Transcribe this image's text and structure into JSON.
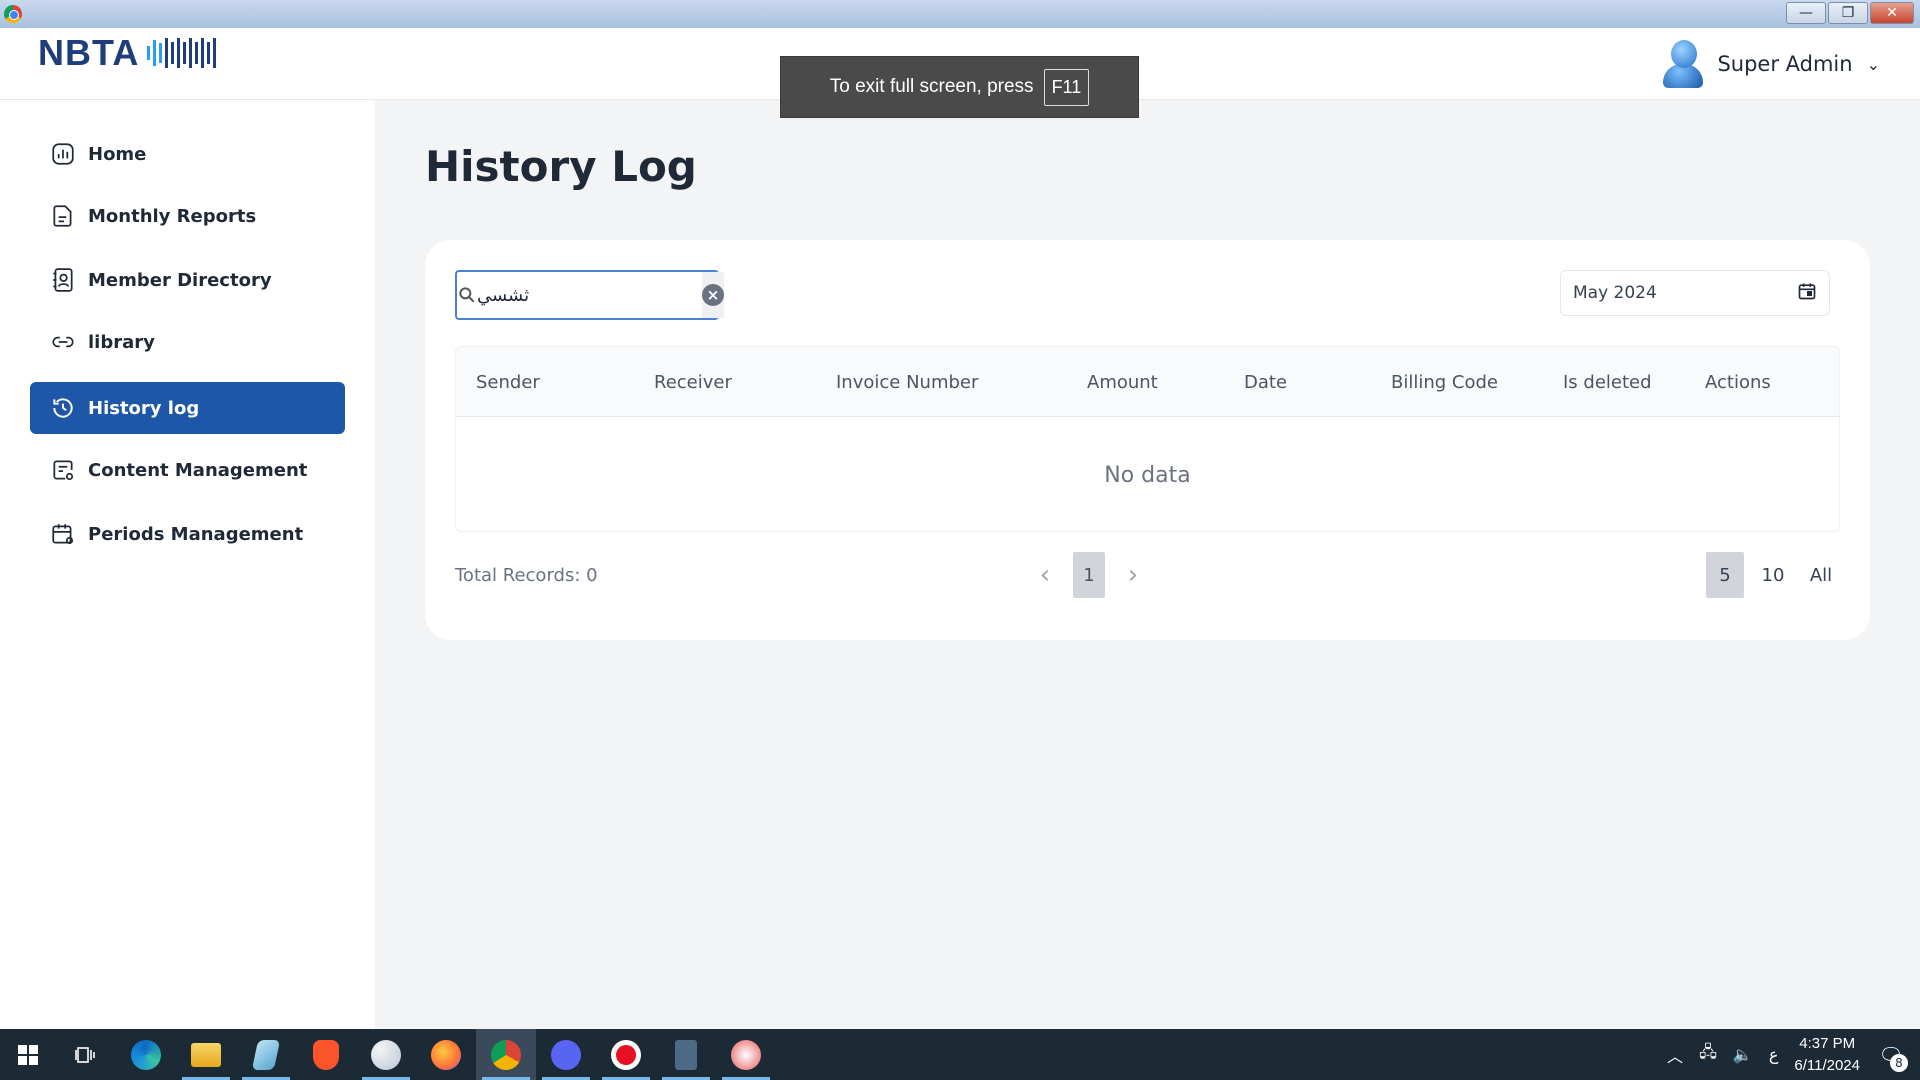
{
  "window": {
    "title_icon": "chrome-icon",
    "controls": {
      "minimize": "—",
      "restore": "❐",
      "close": "✕"
    }
  },
  "header": {
    "logo_text": "NBTA",
    "user": {
      "name": "Super Admin"
    }
  },
  "toast": {
    "text": "To exit full screen, press",
    "key": "F11"
  },
  "sidebar": {
    "items": [
      {
        "label": "Home",
        "icon": "chart-icon"
      },
      {
        "label": "Monthly Reports",
        "icon": "document-icon"
      },
      {
        "label": "Member Directory",
        "icon": "contacts-icon"
      },
      {
        "label": "library",
        "icon": "link-icon"
      },
      {
        "label": "History log",
        "icon": "history-icon",
        "active": true
      },
      {
        "label": "Content Management",
        "icon": "content-settings-icon"
      },
      {
        "label": "Periods Management",
        "icon": "calendar-settings-icon"
      }
    ]
  },
  "main": {
    "title": "History Log",
    "search": {
      "value": "ثشسي",
      "placeholder": ""
    },
    "date_filter": {
      "value": "May 2024"
    },
    "table": {
      "columns": [
        "Sender",
        "Receiver",
        "Invoice Number",
        "Amount",
        "Date",
        "Billing Code",
        "Is deleted",
        "Actions"
      ],
      "rows": [],
      "empty_text": "No data"
    },
    "footer": {
      "total_records": "Total Records: 0",
      "current_page": "1",
      "page_sizes": [
        "5",
        "10",
        "All"
      ],
      "active_page_size": "5"
    }
  },
  "taskbar": {
    "apps": [
      "windows-start",
      "task-view",
      "edge",
      "file-explorer",
      "notepad",
      "brave",
      "paint",
      "firefox",
      "chrome",
      "discord",
      "recorder",
      "calculator",
      "snipping-tool"
    ],
    "tray": {
      "language": "ع",
      "time": "4:37 PM",
      "date": "6/11/2024",
      "notifications": "8"
    }
  }
}
